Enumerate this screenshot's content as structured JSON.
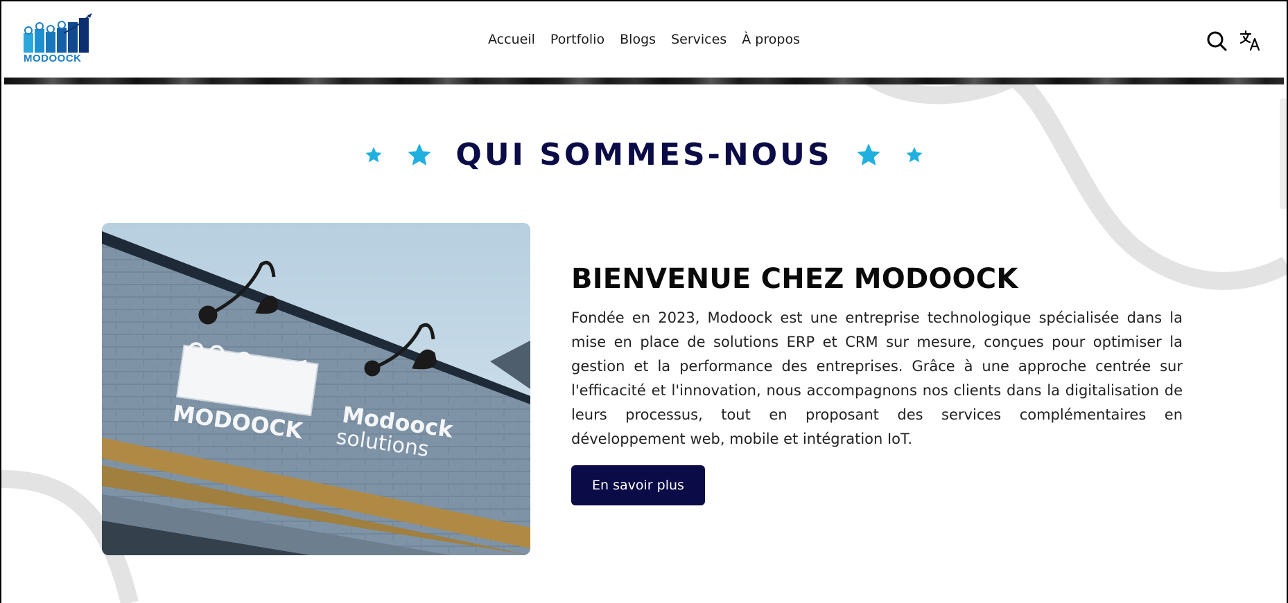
{
  "brand": {
    "logo_text": "MODOOCK"
  },
  "nav": {
    "items": [
      "Accueil",
      "Portfolio",
      "Blogs",
      "Services",
      "À propos"
    ]
  },
  "section": {
    "title": "QUI SOMMES-NOUS"
  },
  "about": {
    "headline": "BIENVENUE CHEZ MODOOCK",
    "paragraph": "Fondée en 2023, Modoock est une entreprise technologique spécialisée dans la mise en place de solutions ERP et CRM sur mesure, conçues pour optimiser la gestion et la performance des entreprises. Grâce à une approche centrée sur l'efficacité et l'innovation, nous accompagnons nos clients dans la digitalisation de leurs processus, tout en proposant des services complémentaires en développement web, mobile et intégration IoT.",
    "cta_label": "En savoir plus"
  },
  "photo": {
    "sign_logo_text": "MODOOCK",
    "sign_line1": "Modoock",
    "sign_line2": "solutions"
  },
  "icons": {
    "search": "search-icon",
    "translate": "translate-icon",
    "star": "star-icon"
  },
  "colors": {
    "navy": "#0b0b47",
    "accent": "#1fb0e0",
    "logo_blue": "#1a7fc4"
  }
}
